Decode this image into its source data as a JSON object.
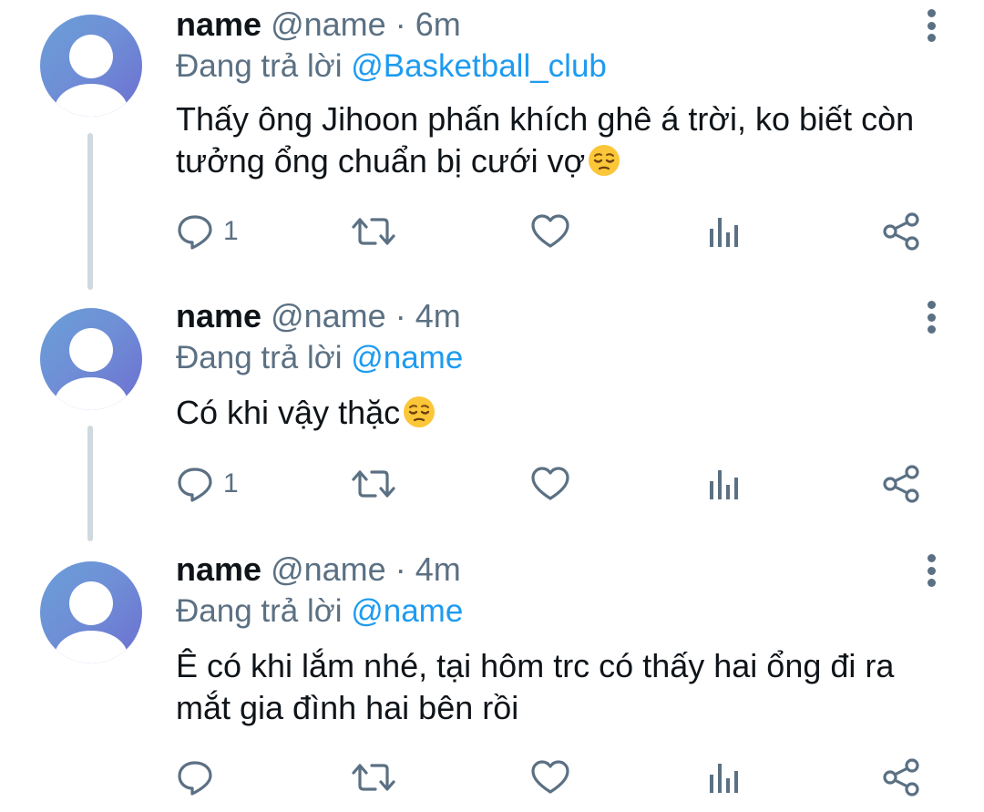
{
  "colors": {
    "text": "#0f1419",
    "muted": "#5b7083",
    "link": "#1d9bf0",
    "thread_line": "#cfd9de"
  },
  "tweets": [
    {
      "display_name": "name",
      "handle": "@name",
      "separator": "·",
      "time": "6m",
      "reply_prefix": "Đang trả lời",
      "reply_to": "@Basketball_club",
      "text": "Thấy ông Jihoon phấn khích ghê á trời, ko biết còn tưởng ổng chuẩn bị cưới vợ",
      "emoji": "pensive-face",
      "reply_count": "1",
      "icons": [
        "reply-icon",
        "retweet-icon",
        "like-icon",
        "analytics-icon",
        "share-icon",
        "more-icon"
      ]
    },
    {
      "display_name": "name",
      "handle": "@name",
      "separator": "·",
      "time": "4m",
      "reply_prefix": "Đang trả lời",
      "reply_to": "@name",
      "text": "Có khi vậy thặc",
      "emoji": "pensive-face",
      "reply_count": "1",
      "icons": [
        "reply-icon",
        "retweet-icon",
        "like-icon",
        "analytics-icon",
        "share-icon",
        "more-icon"
      ]
    },
    {
      "display_name": "name",
      "handle": "@name",
      "separator": "·",
      "time": "4m",
      "reply_prefix": "Đang trả lời",
      "reply_to": "@name",
      "text": "Ê có khi lắm nhé, tại hôm trc có thấy hai ổng đi ra mắt gia đình hai bên rồi",
      "emoji": "",
      "reply_count": "",
      "icons": [
        "reply-icon",
        "retweet-icon",
        "like-icon",
        "analytics-icon",
        "share-icon",
        "more-icon"
      ]
    }
  ]
}
